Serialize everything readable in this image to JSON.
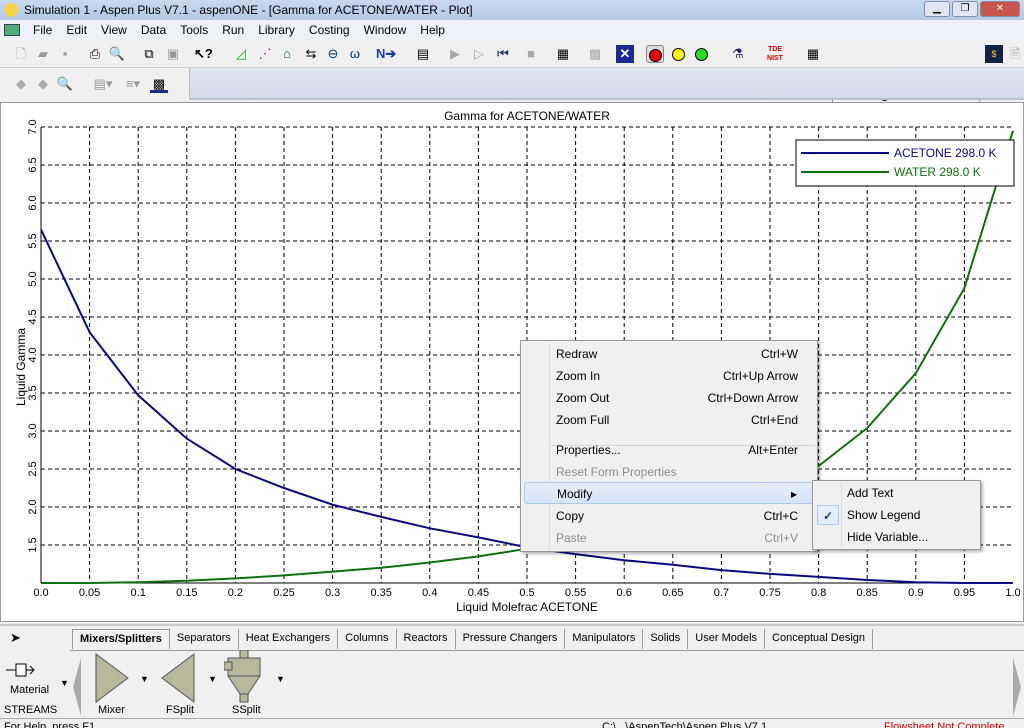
{
  "window": {
    "title": "Simulation 1 - Aspen Plus V7.1 - aspenONE - [Gamma for ACETONE/WATER - Plot]"
  },
  "menubar": [
    "File",
    "Edit",
    "View",
    "Data",
    "Tools",
    "Run",
    "Library",
    "Costing",
    "Window",
    "Help"
  ],
  "toolbar": {
    "costing_status": "Costing: Inactive",
    "icons": [
      "new-icon",
      "open-icon",
      "save-icon",
      "print-icon",
      "print-preview-icon",
      "copy-icon",
      "paste-icon",
      "whats-this-icon",
      "data-browser-icon",
      "flowsheet-icon",
      "model-library-icon",
      "stream-icon",
      "unit-icon",
      "analysis-icon",
      "next-icon",
      "control-panel-icon",
      "run-icon",
      "step-icon",
      "reinit-icon",
      "stop-icon",
      "results-icon",
      "check-icon",
      "close-x-icon",
      "red-light-icon",
      "yellow-light-icon",
      "green-light-icon",
      "flask-icon",
      "nist-tde-icon",
      "grid-icon",
      "cost-icon"
    ],
    "nist_label": "TDE NIST"
  },
  "chart_data": {
    "type": "line",
    "title": "Gamma for ACETONE/WATER",
    "xlabel": "Liquid Molefrac ACETONE",
    "ylabel": "Liquid Gamma",
    "xlim": [
      0,
      1
    ],
    "ylim": [
      1.0,
      7.0
    ],
    "grid": true,
    "legend_position": "top-right",
    "x_ticks": [
      "0.0",
      "0.05",
      "0.1",
      "0.15",
      "0.2",
      "0.25",
      "0.3",
      "0.35",
      "0.4",
      "0.45",
      "0.5",
      "0.55",
      "0.6",
      "0.65",
      "0.7",
      "0.75",
      "0.8",
      "0.85",
      "0.9",
      "0.95",
      "1.0"
    ],
    "y_ticks": [
      "1.5",
      "2.0",
      "2.5",
      "3.0",
      "3.5",
      "4.0",
      "4.5",
      "5.0",
      "5.5",
      "6.0",
      "6.5",
      "7.0"
    ],
    "x": [
      0,
      0.05,
      0.1,
      0.15,
      0.2,
      0.25,
      0.3,
      0.35,
      0.4,
      0.45,
      0.5,
      0.55,
      0.6,
      0.65,
      0.7,
      0.75,
      0.8,
      0.85,
      0.9,
      0.95,
      1.0
    ],
    "series": [
      {
        "name": "ACETONE  298.0 K",
        "color": "#0a0a80",
        "values": [
          5.65,
          4.3,
          3.47,
          2.9,
          2.5,
          2.25,
          2.03,
          1.87,
          1.72,
          1.6,
          1.47,
          1.38,
          1.3,
          1.24,
          1.17,
          1.12,
          1.08,
          1.04,
          1.01,
          1.0,
          1.0
        ]
      },
      {
        "name": "WATER  298.0 K",
        "color": "#107010",
        "values": [
          1.0,
          1.0,
          1.01,
          1.03,
          1.06,
          1.1,
          1.15,
          1.2,
          1.27,
          1.35,
          1.45,
          1.57,
          1.7,
          1.85,
          2.05,
          2.25,
          2.54,
          3.04,
          3.76,
          4.88,
          6.95
        ]
      }
    ]
  },
  "context_menu": {
    "items": [
      {
        "label": "Redraw",
        "shortcut": "Ctrl+W"
      },
      {
        "label": "Zoom In",
        "shortcut": "Ctrl+Up Arrow"
      },
      {
        "label": "Zoom Out",
        "shortcut": "Ctrl+Down Arrow"
      },
      {
        "label": "Zoom Full",
        "shortcut": "Ctrl+End"
      },
      {
        "label": "Properties...",
        "shortcut": "Alt+Enter"
      },
      {
        "label": "Reset Form Properties",
        "shortcut": ""
      },
      {
        "label": "Modify",
        "shortcut": ""
      },
      {
        "label": "Copy",
        "shortcut": "Ctrl+C"
      },
      {
        "label": "Paste",
        "shortcut": "Ctrl+V"
      }
    ],
    "submenu": [
      {
        "label": "Add Text"
      },
      {
        "label": "Show Legend",
        "checked": true
      },
      {
        "label": "Hide Variable..."
      }
    ]
  },
  "palette": {
    "tabs": [
      "Mixers/Splitters",
      "Separators",
      "Heat Exchangers",
      "Columns",
      "Reactors",
      "Pressure Changers",
      "Manipulators",
      "Solids",
      "User Models",
      "Conceptual Design"
    ],
    "streams_label1": "Material",
    "streams_label2": "STREAMS",
    "models": [
      "Mixer",
      "FSplit",
      "SSplit"
    ]
  },
  "statusbar": {
    "help": "For Help, press F1",
    "path": "C:\\...\\AspenTech\\Aspen Plus V7.1",
    "status": "Flowsheet Not Complete"
  }
}
